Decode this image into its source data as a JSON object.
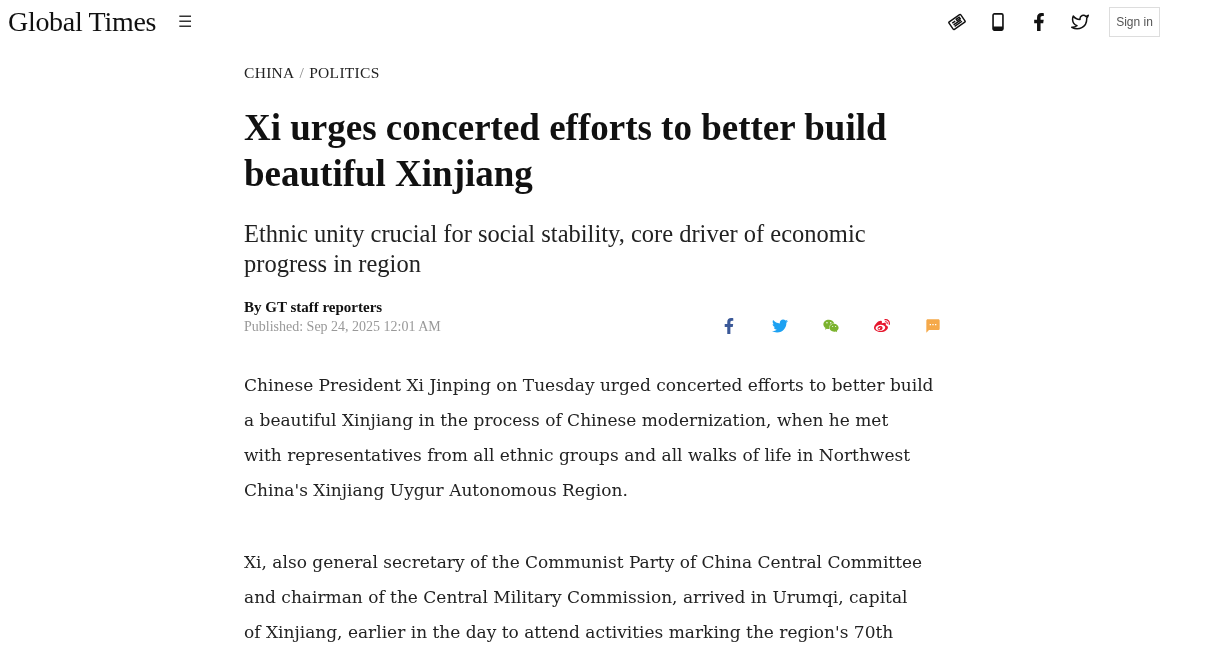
{
  "header": {
    "logo": "Global Times",
    "menu_glyph": "☰",
    "sign_in": "Sign in"
  },
  "article": {
    "breadcrumb": {
      "items": [
        "CHINA",
        "POLITICS"
      ],
      "separator": "/"
    },
    "title": "Xi urges concerted efforts to better build beautiful Xinjiang",
    "subtitle": "Ethnic unity crucial for social stability, core driver of economic progress in region",
    "byline": "By GT staff reporters",
    "published": "Published: Sep 24, 2025 12:01 AM",
    "paragraphs": [
      {
        "lines": [
          "Chinese President Xi Jinping on Tuesday urged concerted efforts to better build",
          "a beautiful Xinjiang in the process of Chinese modernization, when he met",
          "with representatives from all ethnic groups and all walks of life in Northwest",
          "China's Xinjiang Uygur Autonomous Region."
        ]
      },
      {
        "lines": [
          "Xi, also general secretary of the Communist Party of China Central Committee",
          "and chairman of the Central Military Commission, arrived in Urumqi, capital",
          "of Xinjiang, earlier in the day to attend activities marking the region's 70th"
        ]
      }
    ]
  }
}
